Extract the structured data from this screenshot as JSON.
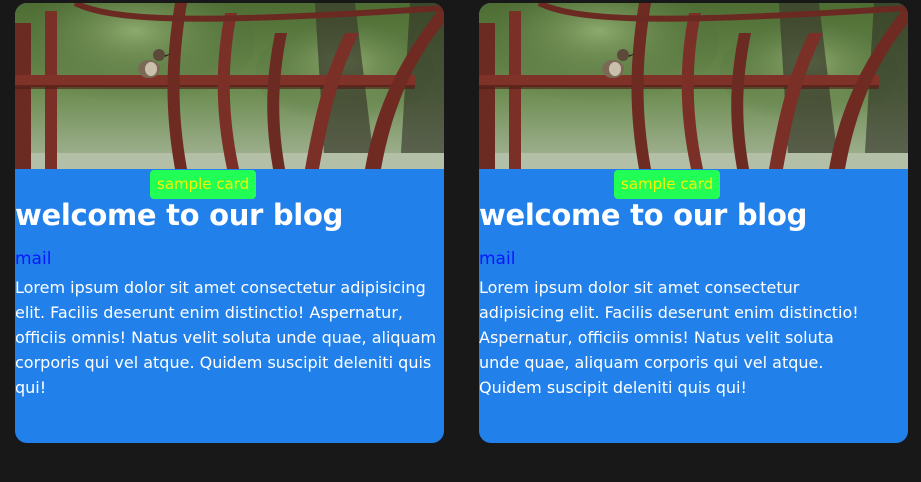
{
  "cards": [
    {
      "tag": "sample card",
      "title": "welcome to our blog",
      "link": "mail",
      "text": "Lorem ipsum dolor sit amet consectetur adipisicing elit. Facilis deserunt enim distinctio! Aspernatur, officiis omnis! Natus velit soluta unde quae, aliquam corporis qui vel atque. Quidem suscipit deleniti quis qui!"
    },
    {
      "tag": "sample card",
      "title": "welcome to our blog",
      "link": "mail",
      "text": "Lorem ipsum dolor sit amet consectetur adipisicing elit. Facilis deserunt enim distinctio! Aspernatur, officiis omnis! Natus velit soluta unde quae, aliquam corporis qui vel atque. Quidem suscipit deleniti quis qui!"
    }
  ],
  "colors": {
    "page_background": "#181818",
    "card_background": "#2180ea",
    "tag_background": "#21ff57",
    "tag_text": "#f6f600",
    "link": "#0a16ff"
  }
}
